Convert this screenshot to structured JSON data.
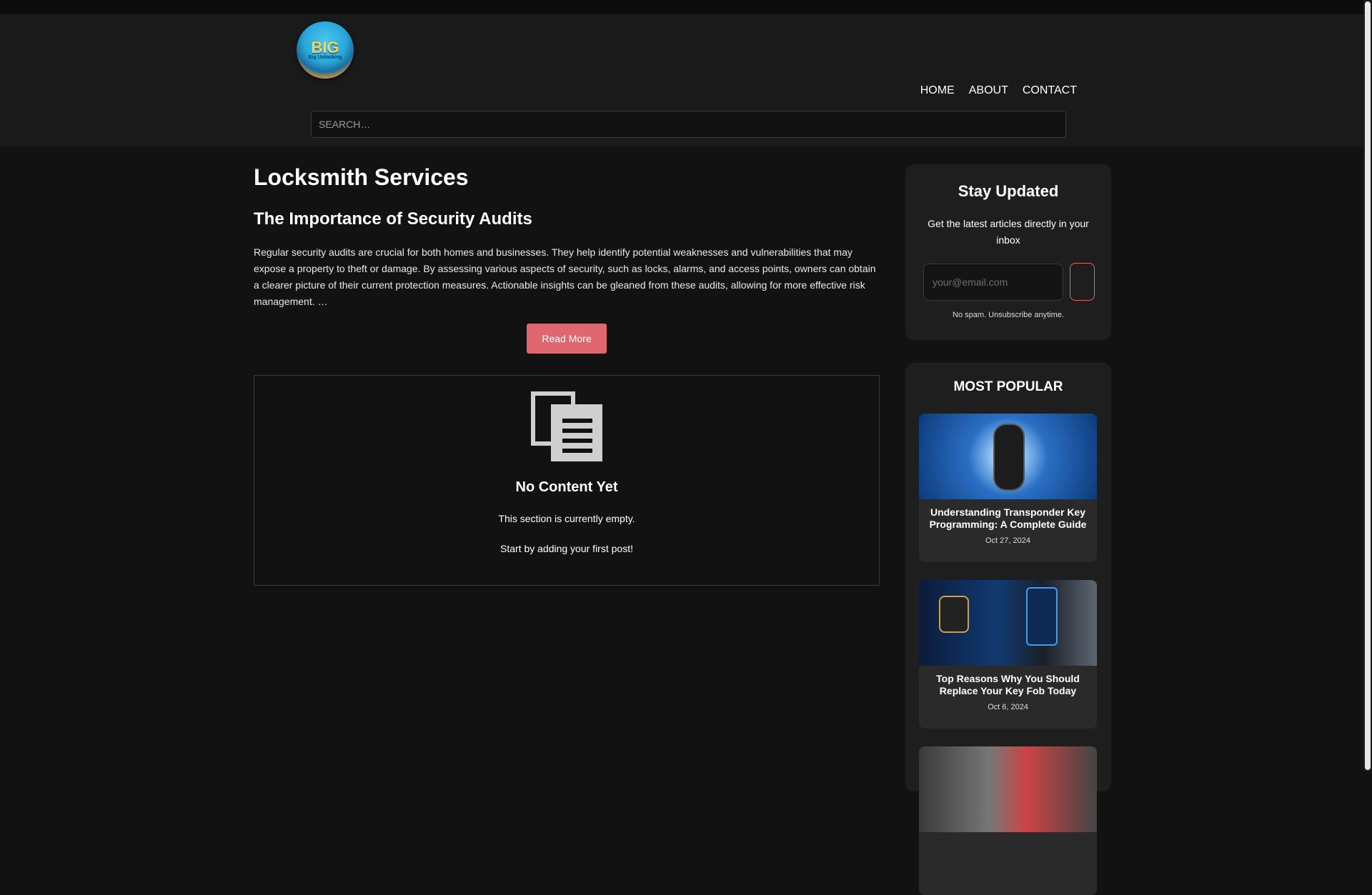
{
  "logo": {
    "text": "BIG",
    "subtext": "Big Unlocking"
  },
  "nav": {
    "items": [
      "HOME",
      "ABOUT",
      "CONTACT"
    ]
  },
  "search": {
    "placeholder": "SEARCH…"
  },
  "main": {
    "page_title": "Locksmith Services",
    "post": {
      "title": "The Importance of Security Audits",
      "excerpt": "Regular security audits are crucial for both homes and businesses. They help identify potential weaknesses and vulnerabilities that may expose a property to theft or damage. By assessing various aspects of security, such as locks, alarms, and access points, owners can obtain a clearer picture of their current protection measures. Actionable insights can be gleaned from these audits, allowing for more effective risk management.   …",
      "read_more": "Read More"
    },
    "empty": {
      "icon": "document-icon",
      "title": "No Content Yet",
      "line1": "This section is currently empty.",
      "line2": "Start by adding your first post!"
    }
  },
  "sidebar": {
    "newsletter": {
      "title": "Stay Updated",
      "description": "Get the latest articles directly in your inbox",
      "email_placeholder": "your@email.com",
      "note": "No spam. Unsubscribe anytime."
    },
    "popular": {
      "title": "MOST POPULAR",
      "posts": [
        {
          "title": "Understanding Transponder Key Programming: A Complete Guide",
          "date": "Oct 27, 2024"
        },
        {
          "title": "Top Reasons Why You Should Replace Your Key Fob Today",
          "date": "Oct 6, 2024"
        }
      ]
    }
  },
  "colors": {
    "accent": "#e06670",
    "background": "#121212",
    "header": "#1a1a1a",
    "card": "#1e1e1e"
  }
}
